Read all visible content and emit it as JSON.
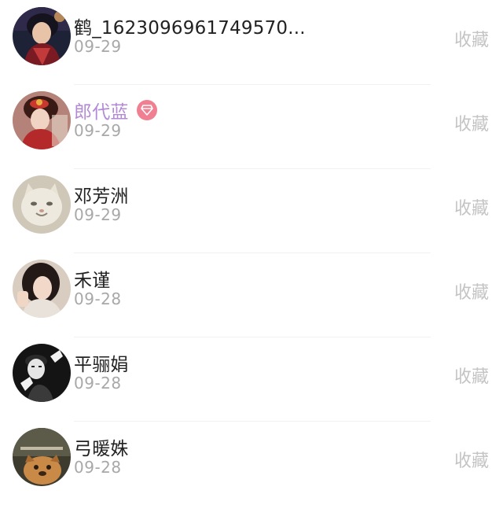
{
  "items": [
    {
      "name": "鹤_1623096961749570...",
      "date": "09-29",
      "action": "收藏",
      "vip": false,
      "avatar": "avatar-dark-portrait"
    },
    {
      "name": "郎代蓝",
      "date": "09-29",
      "action": "收藏",
      "vip": true,
      "avatar": "avatar-red-costume"
    },
    {
      "name": "邓芳洲",
      "date": "09-29",
      "action": "收藏",
      "vip": false,
      "avatar": "avatar-cat"
    },
    {
      "name": "禾谨",
      "date": "09-28",
      "action": "收藏",
      "vip": false,
      "avatar": "avatar-girl"
    },
    {
      "name": "平骊娟",
      "date": "09-28",
      "action": "收藏",
      "vip": false,
      "avatar": "avatar-bw-mime"
    },
    {
      "name": "弓暖姝",
      "date": "09-28",
      "action": "收藏",
      "vip": false,
      "avatar": "avatar-dog-meme"
    }
  ],
  "colors": {
    "vip_name": "#b48ad6",
    "vip_badge": "#f07f92",
    "date": "#a8a8a8",
    "action": "#c4c4c4"
  }
}
